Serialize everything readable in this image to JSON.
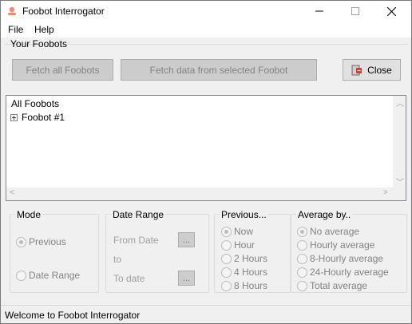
{
  "window": {
    "title": "Foobot Interrogator"
  },
  "icons": {
    "app": "foobot-app-icon",
    "minimize": "minimize-icon",
    "maximize": "maximize-icon",
    "close": "close-x-icon",
    "close_button": "exit-door-icon",
    "expander": "tree-expand-plus-icon"
  },
  "menu": {
    "file": "File",
    "help": "Help"
  },
  "foobots_group": {
    "label": "Your Foobots"
  },
  "buttons": {
    "fetch_all": "Fetch all Foobots",
    "fetch_selected": "Fetch data from selected Foobot",
    "close": "Close"
  },
  "tree": {
    "root": "All Foobots",
    "items": [
      "Foobot #1"
    ]
  },
  "mode": {
    "legend": "Mode",
    "options": [
      {
        "label": "Previous",
        "checked": true
      },
      {
        "label": "Date Range",
        "checked": false
      }
    ]
  },
  "date_range": {
    "legend": "Date Range",
    "from_label": "From Date",
    "to_label": "to",
    "to_date_label": "To date",
    "button": "..."
  },
  "previous": {
    "legend": "Previous...",
    "options": [
      {
        "label": "Now",
        "checked": true
      },
      {
        "label": "Hour",
        "checked": false
      },
      {
        "label": "2 Hours",
        "checked": false
      },
      {
        "label": "4 Hours",
        "checked": false
      },
      {
        "label": "8 Hours",
        "checked": false
      }
    ]
  },
  "average": {
    "legend": "Average by..",
    "options": [
      {
        "label": "No average",
        "checked": true
      },
      {
        "label": "Hourly average",
        "checked": false
      },
      {
        "label": "8-Hourly average",
        "checked": false
      },
      {
        "label": "24-Hourly average",
        "checked": false
      },
      {
        "label": "Total average",
        "checked": false
      }
    ]
  },
  "status": {
    "text": "Welcome to Foobot Interrogator"
  },
  "colors": {
    "disabled_text": "#838383",
    "button_disabled": "#cccccc",
    "accent_red": "#e0352b"
  }
}
